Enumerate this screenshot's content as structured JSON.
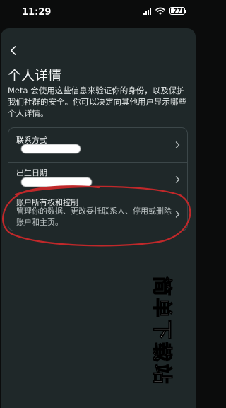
{
  "status_bar": {
    "time": "11:29",
    "battery_level": "77",
    "icons": [
      "signal-icon",
      "wifi-icon",
      "battery-icon"
    ]
  },
  "header": {
    "back_icon": "chevron-left-icon",
    "title": "个人详情"
  },
  "description": "Meta 会使用这些信息来验证你的身份，以及保护我们社群的安全。你可以决定向其他用户显示哪些个人详情。",
  "rows": [
    {
      "label": "联系方式",
      "value_redacted": true,
      "icon": "chevron-right-icon"
    },
    {
      "label": "出生日期",
      "value_redacted": true,
      "icon": "chevron-right-icon"
    },
    {
      "label": "账户所有权和控制",
      "description": "管理你的数据、更改委托联系人、停用或删除账户和主页。",
      "icon": "chevron-right-icon"
    }
  ],
  "watermark": "简单下载站",
  "colors": {
    "background": "#0b0c0c",
    "sheet": "#1f2829",
    "border": "#3c4749",
    "annotation_red": "#c0282a"
  }
}
